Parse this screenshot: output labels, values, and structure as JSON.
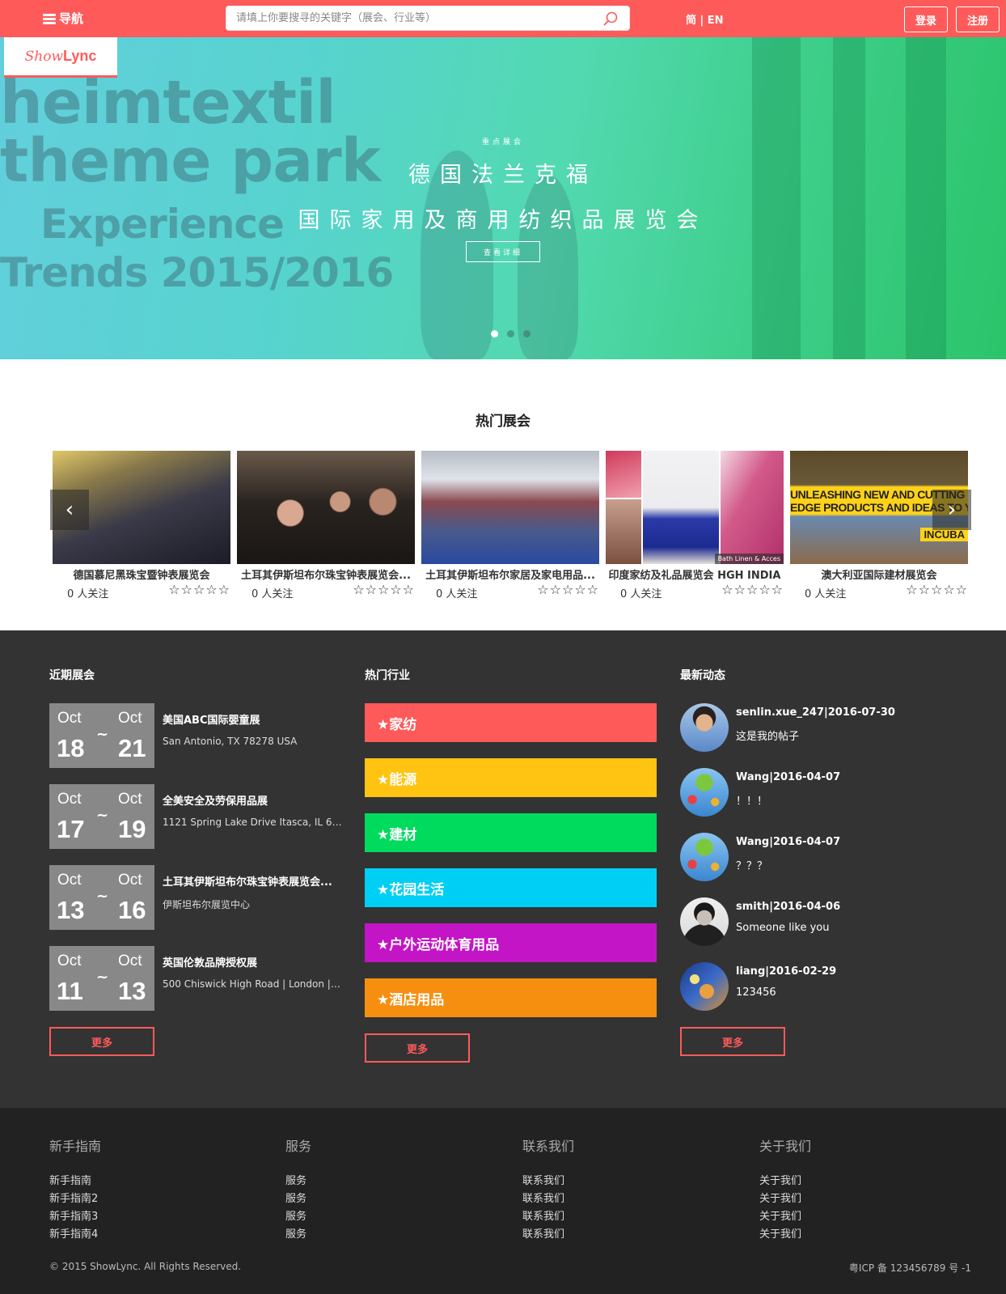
{
  "header": {
    "nav_label": "导航",
    "search_placeholder": "请填上你要搜寻的关键字（展会、行业等）",
    "lang": "简 | EN",
    "login": "登录",
    "register": "注册",
    "brand_color": "#ff5a5a"
  },
  "logo": {
    "text_a": "Show",
    "text_b": "Lync"
  },
  "hero": {
    "background_words": [
      "heimtextil",
      "theme park",
      "Experience",
      "Trends 2015/2016"
    ],
    "kicker": "重点展会",
    "title_line1": "德国法兰克福",
    "title_line2": "国际家用及商用纺织品展览会",
    "button": "查看详细",
    "slide_count": 3,
    "active_slide": 1
  },
  "hot": {
    "title": "热门展会",
    "cards": [
      {
        "name": "德国慕尼黑珠宝暨钟表展览会",
        "follow": "0 人关注",
        "stars": "☆☆☆☆☆"
      },
      {
        "name": "土耳其伊斯坦布尔珠宝钟表展览会...",
        "follow": "0 人关注",
        "stars": "☆☆☆☆☆"
      },
      {
        "name": "土耳其伊斯坦布尔家居及家电用品...",
        "follow": "0 人关注",
        "stars": "☆☆☆☆☆"
      },
      {
        "name": "印度家纺及礼品展览会 HGH INDIA",
        "follow": "0 人关注",
        "stars": "☆☆☆☆☆",
        "image_caption": "Bath Linen & Acces"
      },
      {
        "name": "澳大利亚国际建材展览会",
        "follow": "0 人关注",
        "stars": "☆☆☆☆☆",
        "image_banner_1": "UNLEASHING NEW AND CUTTING",
        "image_banner_2": "EDGE PRODUCTS AND IDEAS TO YO",
        "image_tag": "INCUBA"
      }
    ]
  },
  "recent": {
    "title": "近期展会",
    "events": [
      {
        "m1": "Oct",
        "d1": "18",
        "m2": "Oct",
        "d2": "21",
        "title": "美国ABC国际婴童展",
        "addr": "San Antonio, TX 78278 USA"
      },
      {
        "m1": "Oct",
        "d1": "17",
        "m2": "Oct",
        "d2": "19",
        "title": "全美安全及劳保用品展",
        "addr": "1121 Spring Lake Drive Itasca, IL 60..."
      },
      {
        "m1": "Oct",
        "d1": "13",
        "m2": "Oct",
        "d2": "16",
        "title": "土耳其伊斯坦布尔珠宝钟表展览会...",
        "addr": "伊斯坦布尔展览中心"
      },
      {
        "m1": "Oct",
        "d1": "11",
        "m2": "Oct",
        "d2": "13",
        "title": "英国伦敦品牌授权展",
        "addr": "500 Chiswick High Road | London | ..."
      }
    ],
    "more": "更多"
  },
  "industries": {
    "title": "热门行业",
    "items": [
      {
        "label": "★家纺",
        "color": "#ff5a5a"
      },
      {
        "label": "★能源",
        "color": "#ffc412"
      },
      {
        "label": "★建材",
        "color": "#00db5e"
      },
      {
        "label": "★花园生活",
        "color": "#00cff5"
      },
      {
        "label": "★户外运动体育用品",
        "color": "#c314c6"
      },
      {
        "label": "★酒店用品",
        "color": "#f68f0f"
      }
    ],
    "more": "更多"
  },
  "news": {
    "title": "最新动态",
    "posts": [
      {
        "meta": "senlin.xue_247|2016-07-30",
        "msg": "这是我的帖子",
        "avatar": "person-photo"
      },
      {
        "meta": "Wang|2016-04-07",
        "msg": "！！！",
        "avatar": "balloons-photo"
      },
      {
        "meta": "Wang|2016-04-07",
        "msg": "？？？",
        "avatar": "balloons-photo"
      },
      {
        "meta": "smith|2016-04-06",
        "msg": "Someone like you",
        "avatar": "person-photo"
      },
      {
        "meta": "liang|2016-02-29",
        "msg": "123456",
        "avatar": "painting-photo"
      }
    ],
    "more": "更多"
  },
  "footer": {
    "cols": [
      {
        "title": "新手指南",
        "links": [
          "新手指南",
          "新手指南2",
          "新手指南3",
          "新手指南4"
        ]
      },
      {
        "title": "服务",
        "links": [
          "服务",
          "服务",
          "服务",
          "服务"
        ]
      },
      {
        "title": "联系我们",
        "links": [
          "联系我们",
          "联系我们",
          "联系我们",
          "联系我们"
        ]
      },
      {
        "title": "关于我们",
        "links": [
          "关于我们",
          "关于我们",
          "关于我们",
          "关于我们"
        ]
      }
    ],
    "copyright": "© 2015 ShowLync. All Rights Reserved.",
    "icp": "粤ICP 备 123456789 号 -1"
  }
}
